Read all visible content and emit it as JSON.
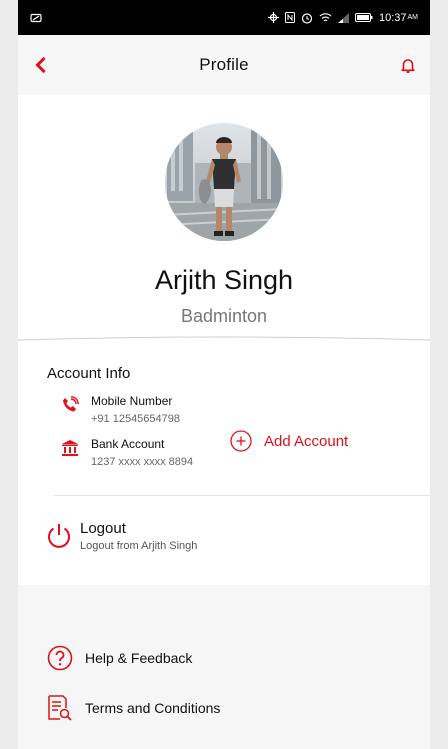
{
  "status_bar": {
    "time": "10:37",
    "ampm": "AM"
  },
  "header": {
    "title": "Profile"
  },
  "profile": {
    "name": "Arjith Singh",
    "sport": "Badminton"
  },
  "account_info": {
    "title": "Account Info",
    "mobile": {
      "label": "Mobile Number",
      "value": "+91 12545654798"
    },
    "bank": {
      "label": "Bank Account",
      "value": "1237 xxxx xxxx 8894"
    },
    "add_account_label": "Add Account"
  },
  "logout": {
    "title": "Logout",
    "subtitle": "Logout from Arjith Singh"
  },
  "menu": {
    "help": "Help & Feedback",
    "terms": "Terms and Conditions"
  },
  "colors": {
    "accent": "#e0101a"
  }
}
